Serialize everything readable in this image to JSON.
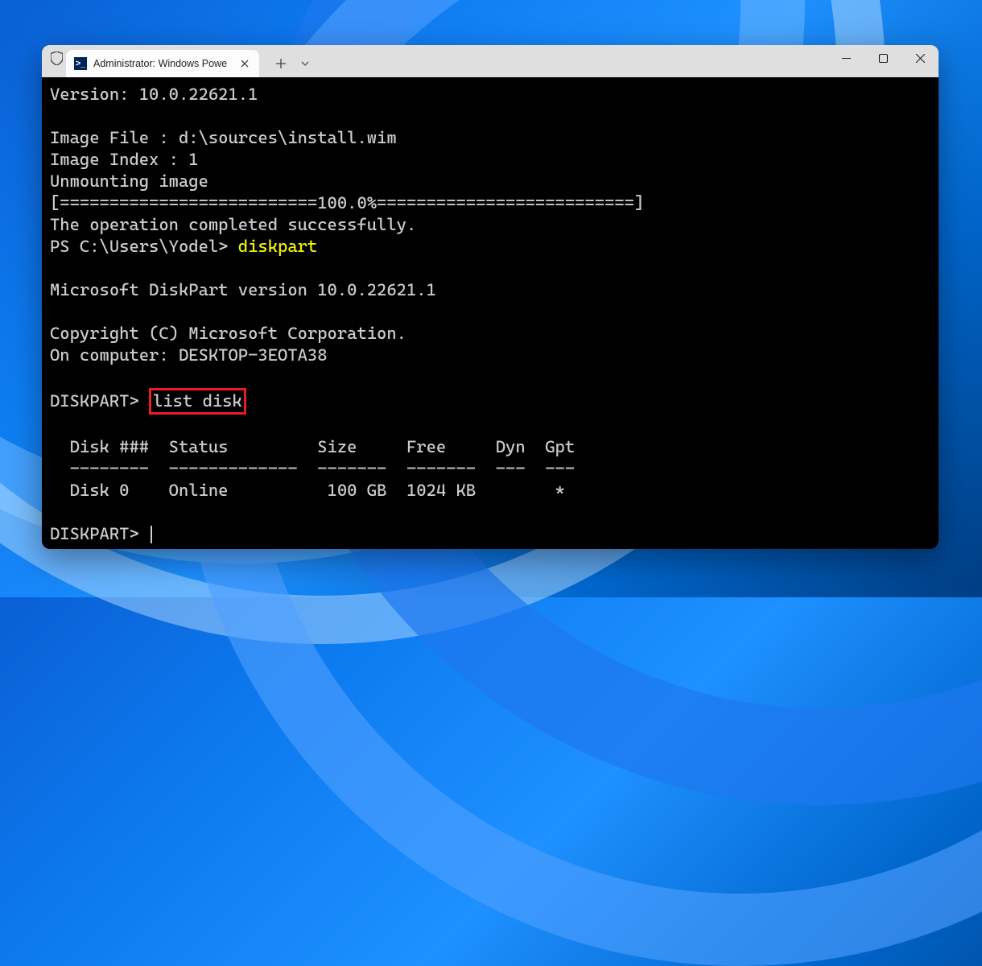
{
  "titlebar": {
    "tab_title": "Administrator: Windows Powe",
    "tab_icon_char": ">_"
  },
  "terminal": {
    "line_version": "Version: 10.0.22621.1",
    "blank1": "",
    "line_imagefile": "Image File : d:\\sources\\install.wim",
    "line_imageindex": "Image Index : 1",
    "line_unmount": "Unmounting image",
    "line_progress": "[==========================100.0%==========================]",
    "line_success": "The operation completed successfully.",
    "prompt_ps": "PS C:\\Users\\Yodel> ",
    "cmd_diskpart": "diskpart",
    "blank2": "",
    "line_dpver": "Microsoft DiskPart version 10.0.22621.1",
    "blank3": "",
    "line_copyright": "Copyright (C) Microsoft Corporation.",
    "line_computer": "On computer: DESKTOP-3EOTA38",
    "blank4": "",
    "prompt_dp1": "DISKPART> ",
    "cmd_listdisk": "list disk",
    "blank5": "",
    "table_header": "  Disk ###  Status         Size     Free     Dyn  Gpt",
    "table_divider": "  --------  -------------  -------  -------  ---  ---",
    "table_row0": "  Disk 0    Online          100 GB  1024 KB        *",
    "blank6": "",
    "prompt_dp2": "DISKPART> "
  }
}
